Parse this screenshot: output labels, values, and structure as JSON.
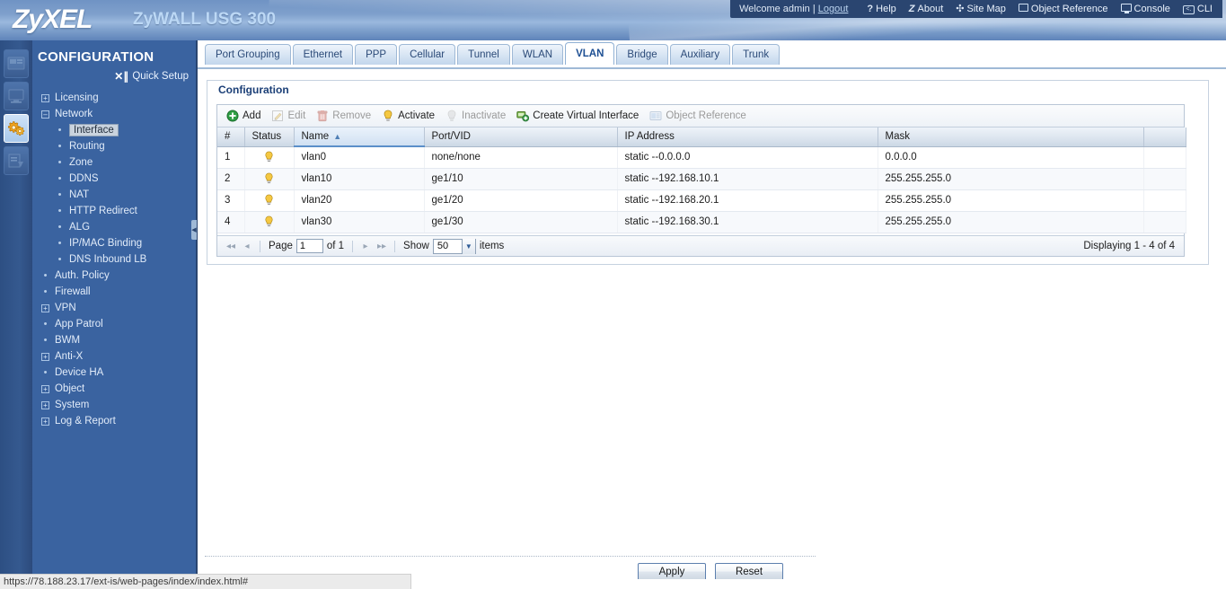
{
  "header": {
    "brand": "ZyXEL",
    "product": "ZyWALL USG 300",
    "welcome_prefix": "Welcome admin",
    "welcome_sep": "|",
    "logout": "Logout",
    "nav": [
      {
        "label": "Help",
        "icon": "help-icon",
        "glyph": "?"
      },
      {
        "label": "About",
        "icon": "about-icon",
        "glyph": "Z"
      },
      {
        "label": "Site Map",
        "icon": "site-map-icon",
        "glyph": "✣"
      },
      {
        "label": "Object Reference",
        "icon": "object-reference-icon",
        "glyph": "▤"
      },
      {
        "label": "Console",
        "icon": "console-icon",
        "glyph": ""
      },
      {
        "label": "CLI",
        "icon": "cli-icon",
        "glyph": "<.."
      }
    ]
  },
  "rail": {
    "items": [
      {
        "name": "dashboard-icon",
        "active": false
      },
      {
        "name": "monitor-icon",
        "active": false
      },
      {
        "name": "configuration-gears-icon",
        "active": true
      },
      {
        "name": "maintenance-icon",
        "active": false
      }
    ]
  },
  "sidebar": {
    "title": "CONFIGURATION",
    "quick_setup": "Quick Setup",
    "tree": [
      {
        "label": "Licensing",
        "level": 1,
        "marker": "plus",
        "selected": false
      },
      {
        "label": "Network",
        "level": 1,
        "marker": "minus",
        "selected": false
      },
      {
        "label": "Interface",
        "level": 2,
        "marker": "dot",
        "selected": true
      },
      {
        "label": "Routing",
        "level": 2,
        "marker": "dot",
        "selected": false
      },
      {
        "label": "Zone",
        "level": 2,
        "marker": "dot",
        "selected": false
      },
      {
        "label": "DDNS",
        "level": 2,
        "marker": "dot",
        "selected": false
      },
      {
        "label": "NAT",
        "level": 2,
        "marker": "dot",
        "selected": false
      },
      {
        "label": "HTTP Redirect",
        "level": 2,
        "marker": "dot",
        "selected": false
      },
      {
        "label": "ALG",
        "level": 2,
        "marker": "dot",
        "selected": false
      },
      {
        "label": "IP/MAC Binding",
        "level": 2,
        "marker": "dot",
        "selected": false
      },
      {
        "label": "DNS Inbound LB",
        "level": 2,
        "marker": "dot",
        "selected": false
      },
      {
        "label": "Auth. Policy",
        "level": 1,
        "marker": "dot",
        "selected": false
      },
      {
        "label": "Firewall",
        "level": 1,
        "marker": "dot",
        "selected": false
      },
      {
        "label": "VPN",
        "level": 1,
        "marker": "plus",
        "selected": false
      },
      {
        "label": "App Patrol",
        "level": 1,
        "marker": "dot",
        "selected": false
      },
      {
        "label": "BWM",
        "level": 1,
        "marker": "dot",
        "selected": false
      },
      {
        "label": "Anti-X",
        "level": 1,
        "marker": "plus",
        "selected": false
      },
      {
        "label": "Device HA",
        "level": 1,
        "marker": "dot",
        "selected": false
      },
      {
        "label": "Object",
        "level": 1,
        "marker": "plus",
        "selected": false
      },
      {
        "label": "System",
        "level": 1,
        "marker": "plus",
        "selected": false
      },
      {
        "label": "Log & Report",
        "level": 1,
        "marker": "plus",
        "selected": false
      }
    ]
  },
  "tabs": [
    {
      "label": "Port Grouping",
      "active": false
    },
    {
      "label": "Ethernet",
      "active": false
    },
    {
      "label": "PPP",
      "active": false
    },
    {
      "label": "Cellular",
      "active": false
    },
    {
      "label": "Tunnel",
      "active": false
    },
    {
      "label": "WLAN",
      "active": false
    },
    {
      "label": "VLAN",
      "active": true
    },
    {
      "label": "Bridge",
      "active": false
    },
    {
      "label": "Auxiliary",
      "active": false
    },
    {
      "label": "Trunk",
      "active": false
    }
  ],
  "panel": {
    "title": "Configuration",
    "toolbar": [
      {
        "label": "Add",
        "icon": "add-icon",
        "disabled": false
      },
      {
        "label": "Edit",
        "icon": "edit-icon",
        "disabled": true
      },
      {
        "label": "Remove",
        "icon": "remove-trash-icon",
        "disabled": true
      },
      {
        "label": "Activate",
        "icon": "activate-bulb-icon",
        "disabled": false
      },
      {
        "label": "Inactivate",
        "icon": "inactivate-bulb-icon",
        "disabled": true
      },
      {
        "label": "Create Virtual Interface",
        "icon": "create-virtual-icon",
        "disabled": false
      },
      {
        "label": "Object Reference",
        "icon": "object-reference-icon",
        "disabled": true
      }
    ],
    "columns": [
      {
        "label": "#",
        "key": "num",
        "sorted": false
      },
      {
        "label": "Status",
        "key": "status",
        "sorted": false
      },
      {
        "label": "Name",
        "key": "name",
        "sorted": true,
        "sort_dir": "asc"
      },
      {
        "label": "Port/VID",
        "key": "portvid",
        "sorted": false
      },
      {
        "label": "IP Address",
        "key": "ip",
        "sorted": false
      },
      {
        "label": "Mask",
        "key": "mask",
        "sorted": false
      }
    ],
    "rows": [
      {
        "num": "1",
        "status": "active",
        "name": "vlan0",
        "portvid": "none/none",
        "ip": "static --0.0.0.0",
        "mask": "0.0.0.0"
      },
      {
        "num": "2",
        "status": "active",
        "name": "vlan10",
        "portvid": "ge1/10",
        "ip": "static --192.168.10.1",
        "mask": "255.255.255.0"
      },
      {
        "num": "3",
        "status": "active",
        "name": "vlan20",
        "portvid": "ge1/20",
        "ip": "static --192.168.20.1",
        "mask": "255.255.255.0"
      },
      {
        "num": "4",
        "status": "active",
        "name": "vlan30",
        "portvid": "ge1/30",
        "ip": "static --192.168.30.1",
        "mask": "255.255.255.0"
      }
    ],
    "pager": {
      "first": "◀❘",
      "prev": "◀",
      "page_label": "Page",
      "page_value": "1",
      "of_label": "of 1",
      "next": "▶",
      "last": "❘▶",
      "show_label": "Show",
      "show_value": "50",
      "items_label": "items",
      "displaying": "Displaying 1 - 4 of 4"
    }
  },
  "footer": {
    "apply": "Apply",
    "reset": "Reset"
  },
  "statusbar": {
    "url": "https://78.188.23.17/ext-is/web-pages/index/index.html#"
  }
}
